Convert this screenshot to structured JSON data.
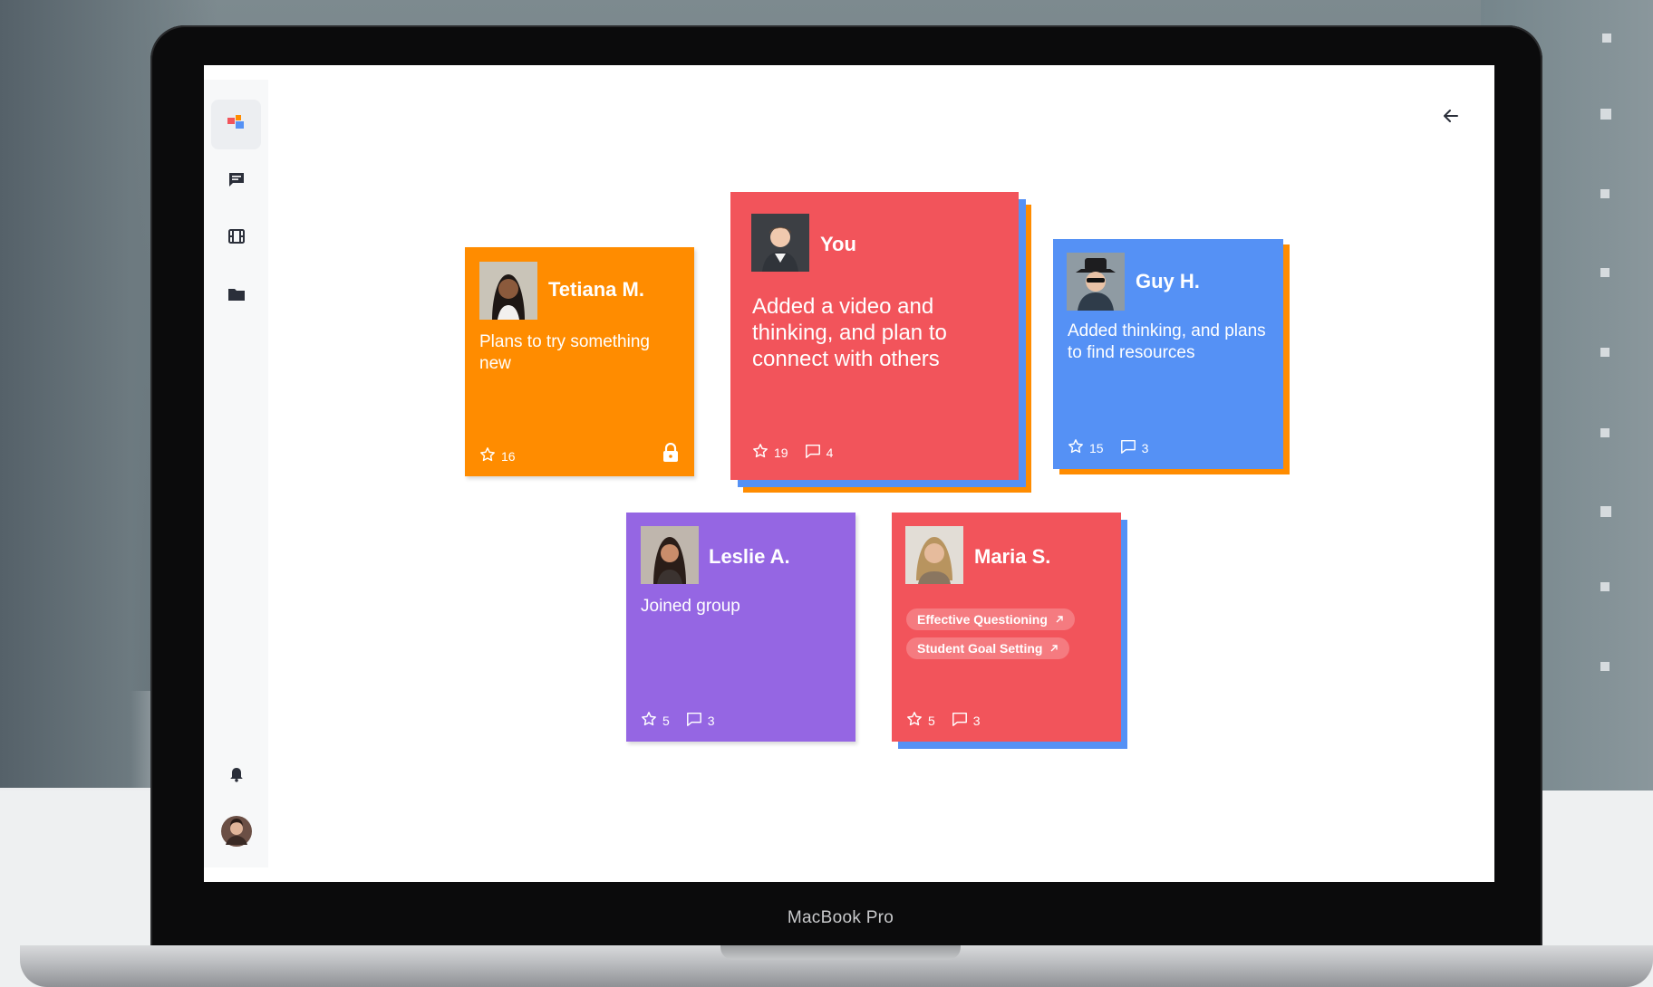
{
  "device": {
    "label": "MacBook Pro"
  },
  "sidebar": {
    "items": [
      {
        "icon": "dashboard-icon",
        "active": true
      },
      {
        "icon": "chat-icon",
        "active": false
      },
      {
        "icon": "film-icon",
        "active": false
      },
      {
        "icon": "folder-icon",
        "active": false
      }
    ],
    "bottom": [
      {
        "icon": "bell-icon"
      },
      {
        "icon": "user-avatar"
      }
    ]
  },
  "header": {
    "back_icon": "arrow-left-icon"
  },
  "colors": {
    "orange": "#ff8c00",
    "red": "#f2545b",
    "blue": "#5591f5",
    "purple": "#9566e3"
  },
  "cards": [
    {
      "name": "Tetiana M.",
      "text": "Plans to try something new",
      "stars": "16",
      "locked": true,
      "color": "#ff8c00"
    },
    {
      "name": "You",
      "text": "Added a video and thinking, and plan to connect with others",
      "stars": "19",
      "comments": "4",
      "color": "#f2545b"
    },
    {
      "name": "Guy H.",
      "text": "Added thinking, and plans to find resources",
      "stars": "15",
      "comments": "3",
      "color": "#5591f5"
    },
    {
      "name": "Leslie A.",
      "text": "Joined group",
      "stars": "5",
      "comments": "3",
      "color": "#9566e3"
    },
    {
      "name": "Maria S.",
      "tags": [
        "Effective Questioning",
        "Student Goal Setting"
      ],
      "stars": "5",
      "comments": "3",
      "color": "#f2545b"
    }
  ]
}
